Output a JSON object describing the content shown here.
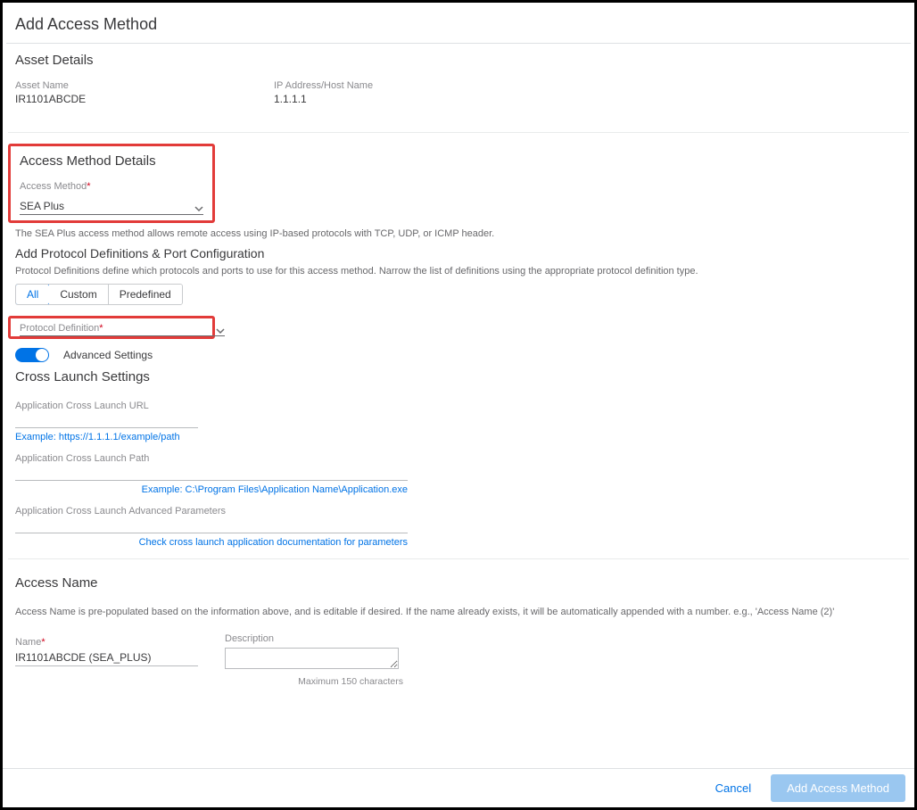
{
  "page_title": "Add Access Method",
  "asset_details": {
    "heading": "Asset Details",
    "asset_name_label": "Asset Name",
    "asset_name_value": "IR1101ABCDE",
    "ip_label": "IP Address/Host Name",
    "ip_value": "1.1.1.1"
  },
  "access_method_details": {
    "heading": "Access Method Details",
    "field_label": "Access Method",
    "field_value": "SEA Plus",
    "description": "The SEA Plus access method allows remote access using IP-based protocols with TCP, UDP, or ICMP header."
  },
  "protocol_section": {
    "heading": "Add Protocol Definitions & Port Configuration",
    "description": "Protocol Definitions define which protocols and ports to use for this access method. Narrow the list of definitions using the appropriate protocol definition type.",
    "tabs": {
      "all": "All",
      "custom": "Custom",
      "predefined": "Predefined"
    },
    "protocol_def_label": "Protocol Definition"
  },
  "advanced_toggle_label": "Advanced Settings",
  "cross_launch": {
    "heading": "Cross Launch Settings",
    "url_label": "Application Cross Launch URL",
    "url_hint": "Example: https://1.1.1.1/example/path",
    "path_label": "Application Cross Launch Path",
    "path_hint": "Example: C:\\Program Files\\Application Name\\Application.exe",
    "adv_label": "Application Cross Launch Advanced Parameters",
    "adv_hint": "Check cross launch application documentation for parameters"
  },
  "access_name": {
    "heading": "Access Name",
    "description": "Access Name is pre-populated based on the information above, and is editable if desired. If the name already exists, it will be automatically appended with a number. e.g., 'Access Name (2)'",
    "name_label": "Name",
    "name_value": "IR1101ABCDE (SEA_PLUS)",
    "desc_label": "Description",
    "max_chars": "Maximum 150 characters"
  },
  "footer": {
    "cancel": "Cancel",
    "submit": "Add Access Method"
  }
}
